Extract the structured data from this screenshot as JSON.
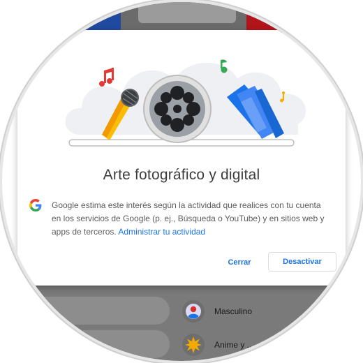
{
  "dialog": {
    "title": "Arte fotográfico y digital",
    "body_text": "Google estima este interés según la actividad que realices con tu cuenta en los servicios de Google (p. ej., Búsqueda o YouTube) y en sitios web y apps de terceros.",
    "link_text": "Administrar tu actividad",
    "close_label": "Cerrar",
    "deactivate_label": "Desactivar"
  },
  "background": {
    "items": [
      {
        "label": "Masculino",
        "icon": "person-avatar-icon"
      },
      {
        "label": "Anime y ...",
        "icon": "starburst-icon"
      }
    ]
  },
  "colors": {
    "accent": "#1a73e8",
    "title": "#3c3c3c",
    "body": "#5b5b5b"
  }
}
